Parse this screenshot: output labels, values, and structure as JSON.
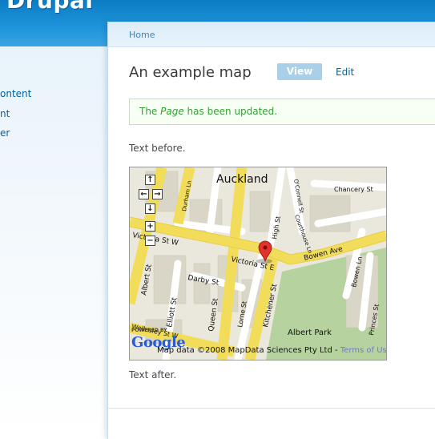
{
  "site": {
    "name": "Drupal"
  },
  "sidebar": {
    "items": [
      {
        "label": "ontent"
      },
      {
        "label": "nt"
      },
      {
        "label": "er"
      }
    ]
  },
  "breadcrumb": {
    "home": "Home"
  },
  "page": {
    "title": "An example map"
  },
  "tabs": {
    "view": "View",
    "edit": "Edit"
  },
  "message": {
    "prefix": "The ",
    "type": "Page",
    "suffix": " has been updated."
  },
  "body": {
    "text_before": "Text before.",
    "text_after": "Text after."
  },
  "map": {
    "city_label": "Auckland",
    "street_labels": [
      "Victoria St W",
      "Victoria St E",
      "Bowen Ave",
      "Albert St",
      "Elliott St",
      "Queen St",
      "Darby St",
      "Lorne St",
      "Kitchener St",
      "Courthouse Ln",
      "Chancery St",
      "O'Connell St",
      "High St",
      "Durham Ln",
      "Princes St",
      "Bowen Ln",
      "Wellesley St W",
      "Albert Park"
    ],
    "logo_powered": "POWERED BY",
    "logo": "Google",
    "attribution": "Map data ©2008 MapData Sciences Pty Ltd - ",
    "terms": "Terms of Use"
  }
}
